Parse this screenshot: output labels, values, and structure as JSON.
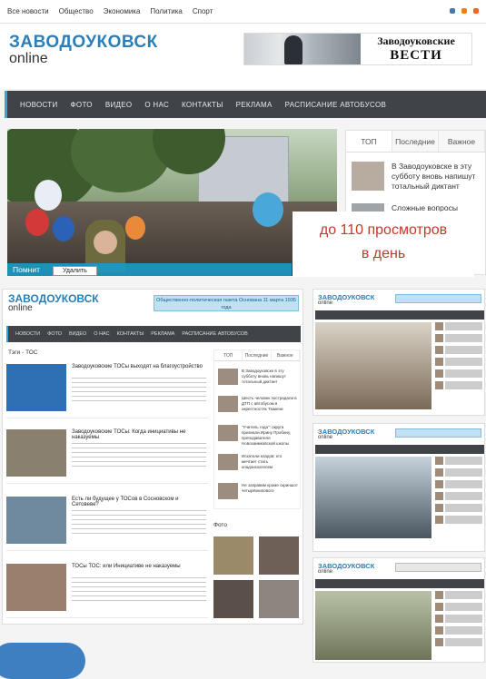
{
  "topbar": {
    "links": [
      "Все новости",
      "Общество",
      "Экономика",
      "Политика",
      "Спорт"
    ]
  },
  "header": {
    "logo_line1": "ЗАВОДОУКОВСК",
    "logo_line2": "online",
    "banner_line1": "Заводоуковские",
    "banner_line2": "ВЕСТИ"
  },
  "nav": {
    "items": [
      "НОВОСТИ",
      "ФОТО",
      "ВИДЕО",
      "О НАС",
      "КОНТАКТЫ",
      "РЕКЛАМА",
      "РАСПИСАНИЕ АВТОБУСОВ"
    ]
  },
  "hero": {
    "caption": "Помнит",
    "context_menu": "Удалить"
  },
  "sidebar": {
    "tabs": [
      "ТОП",
      "Последние",
      "Важное"
    ],
    "items": [
      "В Заводоуковске в эту субботу вновь напишут тотальный диктант",
      "Сложные вопросы"
    ]
  },
  "overlay": {
    "line1": "до 110 просмотров",
    "line2": "в день"
  },
  "shot1": {
    "logo_line1": "ЗАВОДОУКОВСК",
    "logo_line2": "online",
    "banner": "Общественно-политическая газета Основана 11 марта 1935 года",
    "nav": [
      "НОВОСТИ",
      "ФОТО",
      "ВИДЕО",
      "О НАС",
      "КОНТАКТЫ",
      "РЕКЛАМА",
      "РАСПИСАНИЕ АВТОБУСОВ"
    ],
    "section_title": "Тэги - ТОС",
    "articles": [
      {
        "title": "Заводоуковские ТОСы выходят на благоустройство"
      },
      {
        "title": "Заводоуковские ТОСы: Когда инициативы не наказуемы"
      },
      {
        "title": "Есть ли будущее у ТОСов в Сосновском и Сетовеве?"
      },
      {
        "title": "ТОСы ТОС: или Инициативе не наказуемы"
      }
    ],
    "sidebar_tabs": [
      "ТОП",
      "Последние",
      "Важное"
    ],
    "sidebar_items": [
      "В Заводоуковске в эту субботу вновь напишут тотальный диктант",
      "Шесть человек пострадали в ДТП с автобусом в окрестностях Тюмени",
      "\"Учитель года\": округа признали Ирину Пробину, преподавателя Новозаимковской школы",
      "Искатели кладов: кто мечтает стать кладоискателем",
      "Не заправим кроме скриншот четырёхкипового"
    ],
    "photo_title": "Фото"
  },
  "shot2": {
    "logo_line1": "ЗАВОДОУКОВСК",
    "logo_line2": "online"
  },
  "shot3": {
    "logo_line1": "ЗАВОДОУКОВСК",
    "logo_line2": "online"
  },
  "shot4": {
    "logo_line1": "ЗАВОДОУКОВСК",
    "logo_line2": "online"
  }
}
